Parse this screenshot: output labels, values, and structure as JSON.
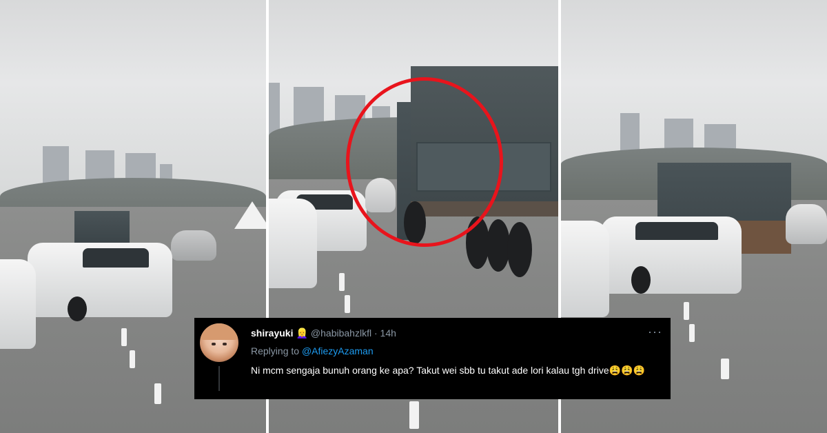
{
  "tweet": {
    "display_name": "shirayuki",
    "badge_emoji": "👱‍♀️",
    "handle": "@habibahzlkfl",
    "separator": "·",
    "timestamp": "14h",
    "replying_prefix": "Replying to ",
    "replying_to": "@AfiezyAzaman",
    "text": "Ni mcm sengaja bunuh orang ke apa? Takut wei sbb tu takut ade lori kalau tgh drive😩😩😩",
    "more_icon": "more-horizontal-icon"
  },
  "colors": {
    "highlight_circle": "#e8141c",
    "tweet_background": "#000000",
    "mention": "#1d9bf0",
    "muted_text": "#8b98a5"
  }
}
